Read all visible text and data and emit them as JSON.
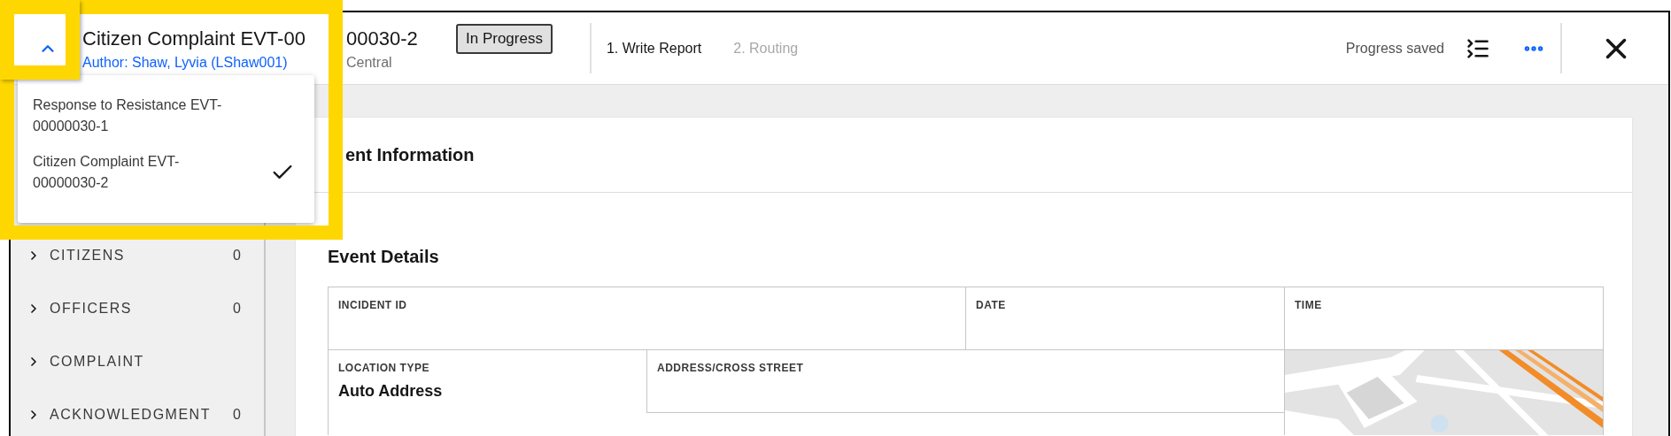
{
  "header": {
    "menu_expanded": true,
    "title_parts": [
      "Citizen Complaint EVT-00",
      "00030-2"
    ],
    "author": "Author: Shaw, Lyvia (LShaw001)",
    "district": "Central",
    "status": "In Progress",
    "steps": [
      {
        "label": "1. Write Report",
        "selected": true
      },
      {
        "label": "2. Routing",
        "selected": false
      }
    ],
    "save_status": "Progress saved"
  },
  "report_menu": [
    {
      "label": "Response to Resistance EVT-00000030-1",
      "selected": false
    },
    {
      "label": "Citizen Complaint EVT-00000030-2",
      "selected": true
    }
  ],
  "sidebar": {
    "items": [
      {
        "label": "CITIZENS",
        "count": "0"
      },
      {
        "label": "OFFICERS",
        "count": "0"
      },
      {
        "label": "COMPLAINT"
      },
      {
        "label": "ACKNOWLEDGMENT",
        "count": "0"
      }
    ]
  },
  "card": {
    "title": "ent Information",
    "section": "Event Details",
    "rows": [
      {
        "cells": [
          {
            "kind": "field",
            "label": "INCIDENT ID"
          },
          {
            "kind": "field",
            "label": "DATE"
          },
          {
            "kind": "field",
            "label": "TIME"
          }
        ]
      },
      {
        "cells": [
          {
            "kind": "field",
            "label": "LOCATION TYPE",
            "value": "Auto Address"
          },
          {
            "kind": "field",
            "label": "ADDRESS/CROSS STREET"
          },
          {
            "kind": "picture"
          }
        ]
      }
    ]
  }
}
